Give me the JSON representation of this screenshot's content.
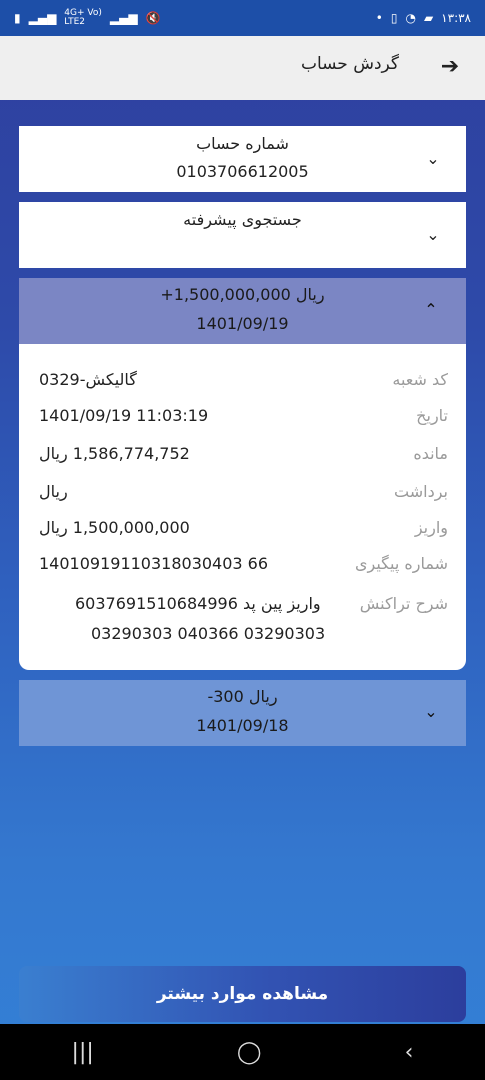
{
  "status_bar": {
    "time": "۱۳:۳۸",
    "left_icons": [
      "battery-icon",
      "signal-icon",
      "lte-icon",
      "signal-icon",
      "mute-icon"
    ],
    "right_icons": [
      "dot-icon",
      "sim-icon",
      "whatsapp-icon",
      "message-icon"
    ],
    "lte_label_top": "4G+ Vo)",
    "lte_label_bottom": "LTE2"
  },
  "app_bar": {
    "title": "گردش حساب"
  },
  "account": {
    "label": "شماره حساب",
    "number": "0103706612005"
  },
  "advanced_search": {
    "label": "جستجوی پیشرفته"
  },
  "transaction_1": {
    "amount": "+1,500,000,000 ریال",
    "date": "1401/09/19",
    "details": {
      "branch_label": "کد شعبه",
      "branch_value": "گالیکش-0329",
      "date_label": "تاریخ",
      "date_value": "1401/09/19   11:03:19",
      "balance_label": "مانده",
      "balance_value": "1,586,774,752 ریال",
      "withdraw_label": "برداشت",
      "withdraw_value": "ریال",
      "deposit_label": "واریز",
      "deposit_value": "1,500,000,000 ریال",
      "tracking_label": "شماره پیگیری",
      "tracking_value": "14010919110318030403 66",
      "description_label": "شرح تراکنش",
      "description_line1": "واریز پین پد 6037691510684996",
      "description_line2": "03290303 040366 03290303"
    }
  },
  "transaction_2": {
    "amount": "-300 ریال",
    "date": "1401/09/18"
  },
  "more_button": {
    "label": "مشاهده موارد بیشتر"
  },
  "nav": {
    "recent": "|||",
    "home": "◯",
    "back": "‹"
  }
}
